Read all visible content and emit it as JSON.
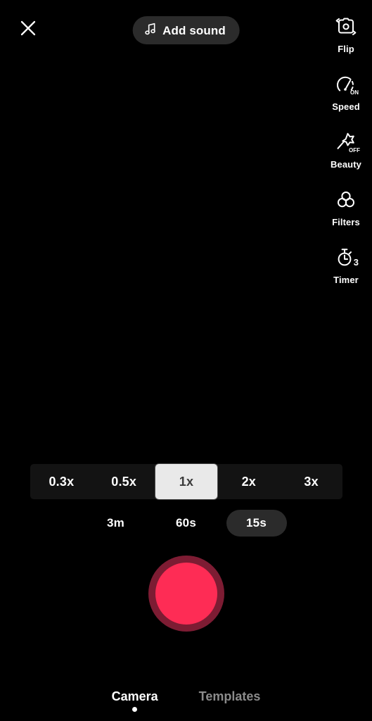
{
  "app": {
    "screen_name": "Camera",
    "background_color": "#000000",
    "accent_color": "#fe2c55"
  },
  "top_bar": {
    "close": {
      "icon": "close-icon",
      "label": "Close"
    },
    "add_sound": {
      "icon": "music-note-icon",
      "label": "Add sound"
    }
  },
  "tool_rail": {
    "items": [
      {
        "label": "Flip",
        "icon": "flip-camera-icon",
        "badge": ""
      },
      {
        "label": "Speed",
        "icon": "speedometer-icon",
        "badge": "ON"
      },
      {
        "label": "Beauty",
        "icon": "magic-wand-star-icon",
        "badge": "OFF"
      },
      {
        "label": "Filters",
        "icon": "filters-circles-icon",
        "badge": ""
      },
      {
        "label": "Timer",
        "icon": "stopwatch-icon",
        "badge": "3"
      }
    ]
  },
  "zoom_bar": {
    "options": [
      {
        "label": "0.3x",
        "selected": false
      },
      {
        "label": "0.5x",
        "selected": false
      },
      {
        "label": "1x",
        "selected": true
      },
      {
        "label": "2x",
        "selected": false
      },
      {
        "label": "3x",
        "selected": false
      }
    ],
    "selected_value": "1x",
    "selected_chip_bg": "#e9e9e9",
    "bar_bg": "#131313"
  },
  "duration_bar": {
    "options": [
      {
        "label": "3m",
        "selected": false
      },
      {
        "label": "60s",
        "selected": false
      },
      {
        "label": "15s",
        "selected": true
      }
    ],
    "selected_value": "15s"
  },
  "record_button": {
    "name": "record-button",
    "inner_color": "#fe2c55",
    "ring_color": "#7d1c33"
  },
  "tab_bar": {
    "tabs": [
      {
        "label": "Camera",
        "active": true
      },
      {
        "label": "Templates",
        "active": false
      }
    ]
  }
}
